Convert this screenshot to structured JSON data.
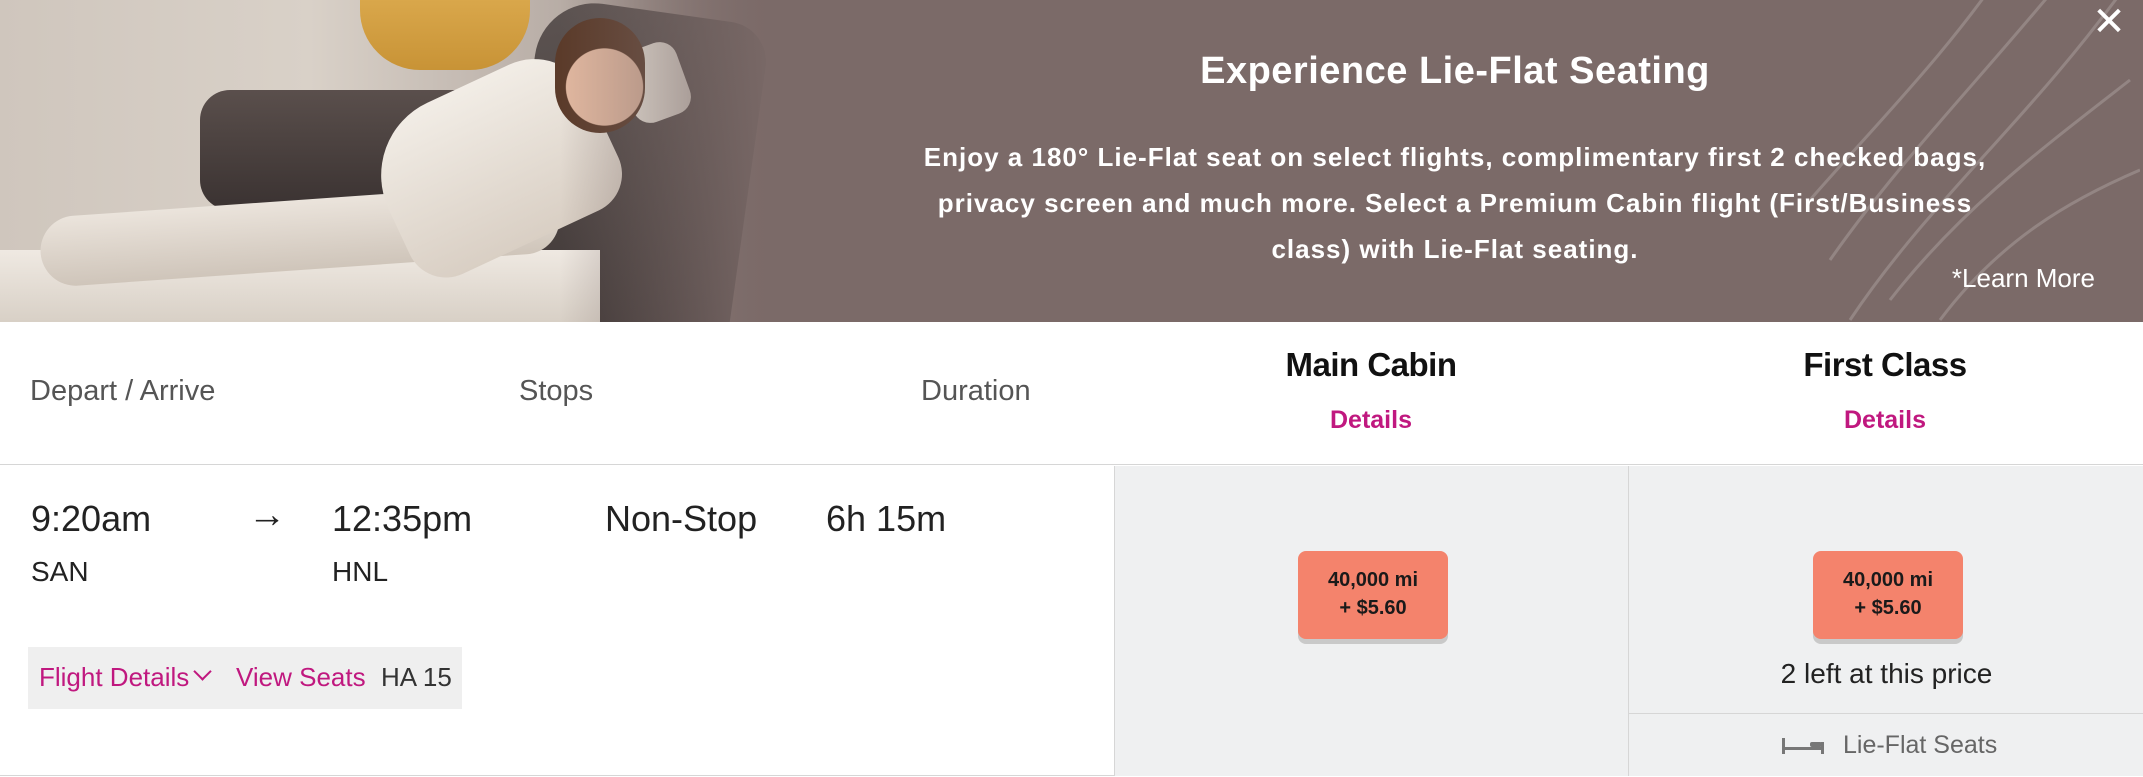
{
  "banner": {
    "title": "Experience Lie-Flat Seating",
    "text": "Enjoy a 180° Lie-Flat seat on select flights, complimentary first 2 checked bags, privacy screen and much more. Select a Premium Cabin flight (First/Business class) with Lie-Flat seating.",
    "learn_more": "*Learn More",
    "close_icon": "✕",
    "background_color": "#7b6a68"
  },
  "columns": {
    "depart_arrive": "Depart / Arrive",
    "stops": "Stops",
    "duration": "Duration"
  },
  "cabins": [
    {
      "name": "Main Cabin",
      "details": "Details"
    },
    {
      "name": "First Class",
      "details": "Details"
    }
  ],
  "flight": {
    "depart_time": "9:20am",
    "arrow": "→",
    "arrive_time": "12:35pm",
    "depart_airport": "SAN",
    "arrive_airport": "HNL",
    "stops": "Non-Stop",
    "duration": "6h 15m",
    "flight_details_label": "Flight Details",
    "view_seats_label": "View Seats",
    "flight_number": "HA 15"
  },
  "fares": {
    "main_cabin": {
      "miles": "40,000 mi",
      "fee": "+ $5.60"
    },
    "first_class": {
      "miles": "40,000 mi",
      "fee": "+ $5.60",
      "availability": "2 left at this price",
      "feature": "Lie-Flat Seats"
    }
  },
  "colors": {
    "accent": "#c0187f",
    "price_button": "#f4836c",
    "fare_cell_bg": "#eff0f1"
  }
}
